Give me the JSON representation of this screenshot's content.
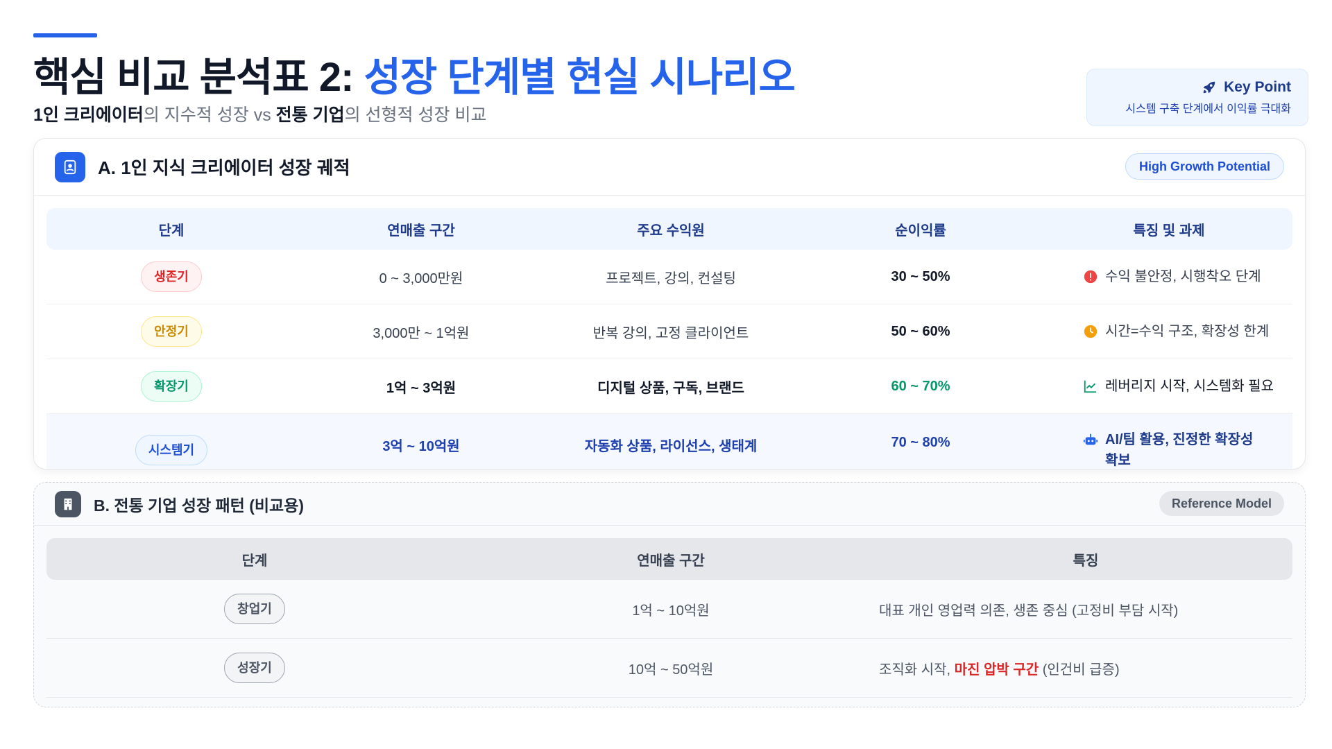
{
  "header": {
    "title_main": "핵심 비교 분석표 2:",
    "title_highlight": "성장 단계별 현실 시나리오",
    "subtitle_b1": "1인 크리에이터",
    "subtitle_t1": "의 지수적 성장 vs ",
    "subtitle_b2": "전통 기업",
    "subtitle_t2": "의 선형적 성장 비교"
  },
  "key_point": {
    "icon": "rocket-icon",
    "title": "Key Point",
    "desc": "시스템 구축 단계에서 이익률 극대화"
  },
  "section_a": {
    "icon": "user-icon",
    "title": "A. 1인 지식 크리에이터 성장 궤적",
    "pill": "High Growth Potential",
    "headers": [
      "단계",
      "연매출 구간",
      "주요 수익원",
      "순이익률",
      "특징 및 과제"
    ],
    "rows": [
      {
        "stage": "생존기",
        "revenue": "0 ~ 3,000만원",
        "source": "프로젝트, 강의, 컨설팅",
        "margin": "30 ~ 50%",
        "note": "수익 불안정, 시행착오 단계",
        "icon": "alert-icon"
      },
      {
        "stage": "안정기",
        "revenue": "3,000만 ~ 1억원",
        "source": "반복 강의, 고정 클라이언트",
        "margin": "50 ~ 60%",
        "note": "시간=수익 구조, 확장성 한계",
        "icon": "clock-icon"
      },
      {
        "stage": "확장기",
        "revenue": "1억 ~ 3억원",
        "source": "디지털 상품, 구독, 브랜드",
        "margin": "60 ~ 70%",
        "note": "레버리지 시작, 시스템화 필요",
        "icon": "chart-line-icon"
      },
      {
        "stage": "시스템기",
        "revenue": "3억 ~ 10억원",
        "source": "자동화 상품, 라이선스, 생태계",
        "margin": "70 ~ 80%",
        "note": "AI/팀 활용, 진정한 확장성 확보",
        "icon": "robot-icon"
      }
    ]
  },
  "section_b": {
    "icon": "building-icon",
    "title": "B. 전통 기업 성장 패턴 (비교용)",
    "pill": "Reference Model",
    "headers": [
      "단계",
      "연매출 구간",
      "특징"
    ],
    "rows": [
      {
        "stage": "창업기",
        "revenue": "1억 ~ 10억원",
        "note_pre": "대표 개인 영업력 의존, 생존 중심 (고정비 부담 시작)",
        "note_hl": "",
        "note_post": ""
      },
      {
        "stage": "성장기",
        "revenue": "10억 ~ 50억원",
        "note_pre": "조직화 시작, ",
        "note_hl": "마진 압박 구간",
        "note_post": " (인건비 급증)"
      }
    ]
  },
  "colors": {
    "accent": "#2563eb",
    "red": "#dc2626",
    "yellow": "#ca8a04",
    "green": "#059669",
    "navy": "#1e3a8a"
  }
}
